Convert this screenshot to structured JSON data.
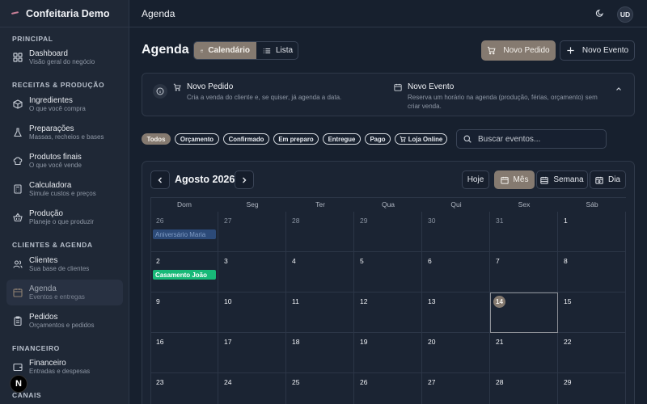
{
  "app": {
    "brand": "Confeitaria Demo"
  },
  "sidebar": {
    "sections": [
      {
        "label": "PRINCIPAL"
      },
      {
        "label": "RECEITAS & PRODUÇÃO"
      },
      {
        "label": "CLIENTES & AGENDA"
      },
      {
        "label": "FINANCEIRO"
      },
      {
        "label": "CANAIS"
      }
    ],
    "items": [
      {
        "title": "Dashboard",
        "sub": "Visão geral do negócio",
        "icon": "dashboard-icon"
      },
      {
        "title": "Ingredientes",
        "sub": "O que você compra",
        "icon": "box-icon"
      },
      {
        "title": "Preparações",
        "sub": "Massas, recheios e bases",
        "icon": "flask-icon"
      },
      {
        "title": "Produtos finais",
        "sub": "O que você vende",
        "icon": "chef-hat-icon"
      },
      {
        "title": "Calculadora",
        "sub": "Simule custos e preços",
        "icon": "calculator-icon"
      },
      {
        "title": "Produção",
        "sub": "Planeje o que produzir",
        "icon": "basket-icon"
      },
      {
        "title": "Clientes",
        "sub": "Sua base de clientes",
        "icon": "users-icon"
      },
      {
        "title": "Agenda",
        "sub": "Eventos e entregas",
        "icon": "calendar-icon"
      },
      {
        "title": "Pedidos",
        "sub": "Orçamentos e pedidos",
        "icon": "clipboard-icon"
      },
      {
        "title": "Financeiro",
        "sub": "Entradas e despesas",
        "icon": "wallet-icon"
      }
    ],
    "badge": "N"
  },
  "header": {
    "title": "Agenda",
    "avatar": "UD"
  },
  "main": {
    "title": "Agenda",
    "view_toggle": {
      "calendar": "Calendário",
      "list": "Lista"
    },
    "new_order": "Novo Pedido",
    "new_event": "Novo Evento",
    "info": {
      "order_title": "Novo Pedido",
      "order_desc": "Cria a venda do cliente e, se quiser, já agenda a data.",
      "event_title": "Novo Evento",
      "event_desc_1": "Reserva um horário na agenda (produção, férias, orçamento) sem",
      "event_desc_2": "criar venda."
    },
    "filters": [
      "Todos",
      "Orçamento",
      "Confirmado",
      "Em preparo",
      "Entregue",
      "Pago",
      "Loja Online"
    ],
    "search_placeholder": "Buscar eventos..."
  },
  "calendar": {
    "month_label": "Agosto 2026",
    "today_btn": "Hoje",
    "month_btn": "Mês",
    "week_btn": "Semana",
    "day_btn": "Dia",
    "weekdays": [
      "Dom",
      "Seg",
      "Ter",
      "Qua",
      "Qui",
      "Sex",
      "Sáb"
    ],
    "days": [
      [
        "26",
        "27",
        "28",
        "29",
        "30",
        "31",
        "1"
      ],
      [
        "2",
        "3",
        "4",
        "5",
        "6",
        "7",
        "8"
      ],
      [
        "9",
        "10",
        "11",
        "12",
        "13",
        "14",
        "15"
      ],
      [
        "16",
        "17",
        "18",
        "19",
        "20",
        "21",
        "22"
      ],
      [
        "23",
        "24",
        "25",
        "26",
        "27",
        "28",
        "29"
      ]
    ],
    "events": [
      {
        "label": "Aniversário Maria",
        "week": 0,
        "day": 0,
        "style": "muted"
      },
      {
        "label": "Casamento João",
        "week": 1,
        "day": 0,
        "style": "green"
      }
    ],
    "today": {
      "week": 2,
      "day": 5
    }
  }
}
